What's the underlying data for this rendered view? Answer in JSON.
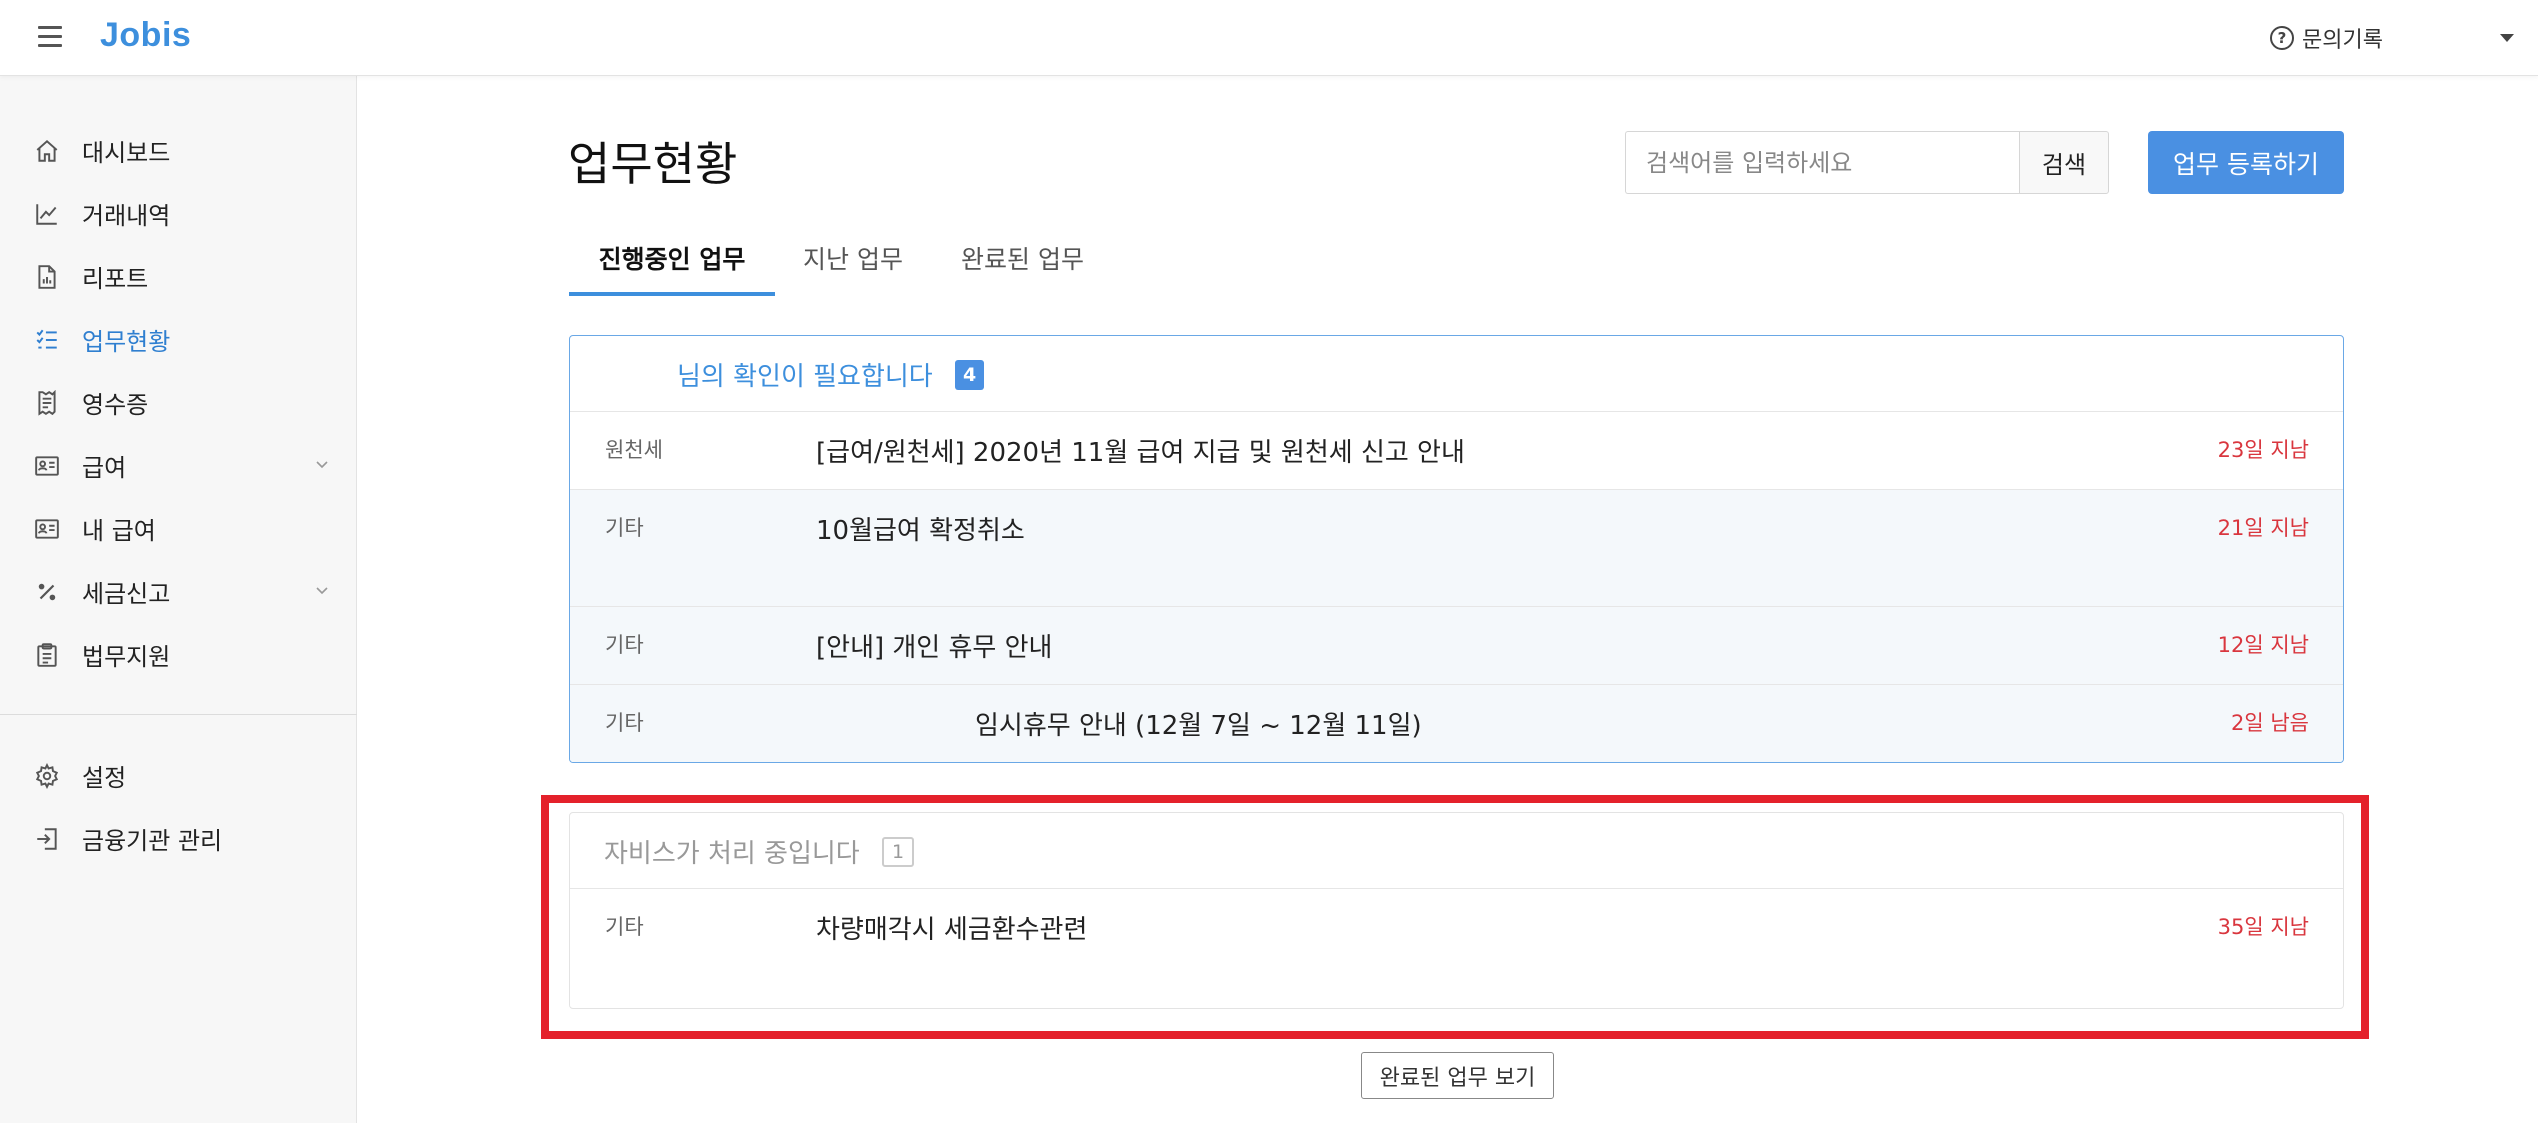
{
  "header": {
    "logo": "Jobis",
    "help_label": "문의기록",
    "help_icon": "?"
  },
  "sidebar": {
    "items": [
      {
        "label": "대시보드",
        "icon": "home-icon"
      },
      {
        "label": "거래내역",
        "icon": "trend-chart-icon"
      },
      {
        "label": "리포트",
        "icon": "report-document-icon"
      },
      {
        "label": "업무현황",
        "icon": "task-list-icon",
        "active": true
      },
      {
        "label": "영수증",
        "icon": "receipt-icon"
      },
      {
        "label": "급여",
        "icon": "id-card-icon",
        "expandable": true
      },
      {
        "label": "내 급여",
        "icon": "id-card-icon"
      },
      {
        "label": "세금신고",
        "icon": "percent-icon",
        "expandable": true
      },
      {
        "label": "법무지원",
        "icon": "clipboard-icon"
      }
    ],
    "bottom_items": [
      {
        "label": "설정",
        "icon": "gear-icon"
      },
      {
        "label": "금융기관 관리",
        "icon": "login-arrow-icon"
      }
    ]
  },
  "main": {
    "title": "업무현황",
    "search": {
      "placeholder": "검색어를 입력하세요",
      "button": "검색"
    },
    "register_button": "업무 등록하기",
    "tabs": [
      {
        "label": "진행중인 업무",
        "active": true
      },
      {
        "label": "지난 업무"
      },
      {
        "label": "완료된 업무"
      }
    ],
    "confirm_panel": {
      "title": "님의 확인이 필요합니다",
      "count": "4",
      "rows": [
        {
          "category": "원천세",
          "subject": "[급여/원천세] 2020년 11월 급여 지급 및 원천세 신고 안내",
          "due": "23일 지남"
        },
        {
          "category": "기타",
          "subject": "10월급여 확정취소",
          "due": "21일 지남"
        },
        {
          "category": "기타",
          "subject": "[안내] 개인 휴무 안내",
          "due": "12일 지남"
        },
        {
          "category": "기타",
          "subject": "임시휴무 안내 (12월 7일 ~ 12월 11일)",
          "due": "2일 남음"
        }
      ]
    },
    "processing_panel": {
      "title": "자비스가 처리 중입니다",
      "count": "1",
      "rows": [
        {
          "category": "기타",
          "subject": "차량매각시 세금환수관련",
          "due": "35일 지남"
        }
      ]
    },
    "more_button": "완료된 업무 보기"
  },
  "colors": {
    "accent": "#4a90e2",
    "overdue": "#d9363e",
    "highlight": "#e4212b"
  }
}
